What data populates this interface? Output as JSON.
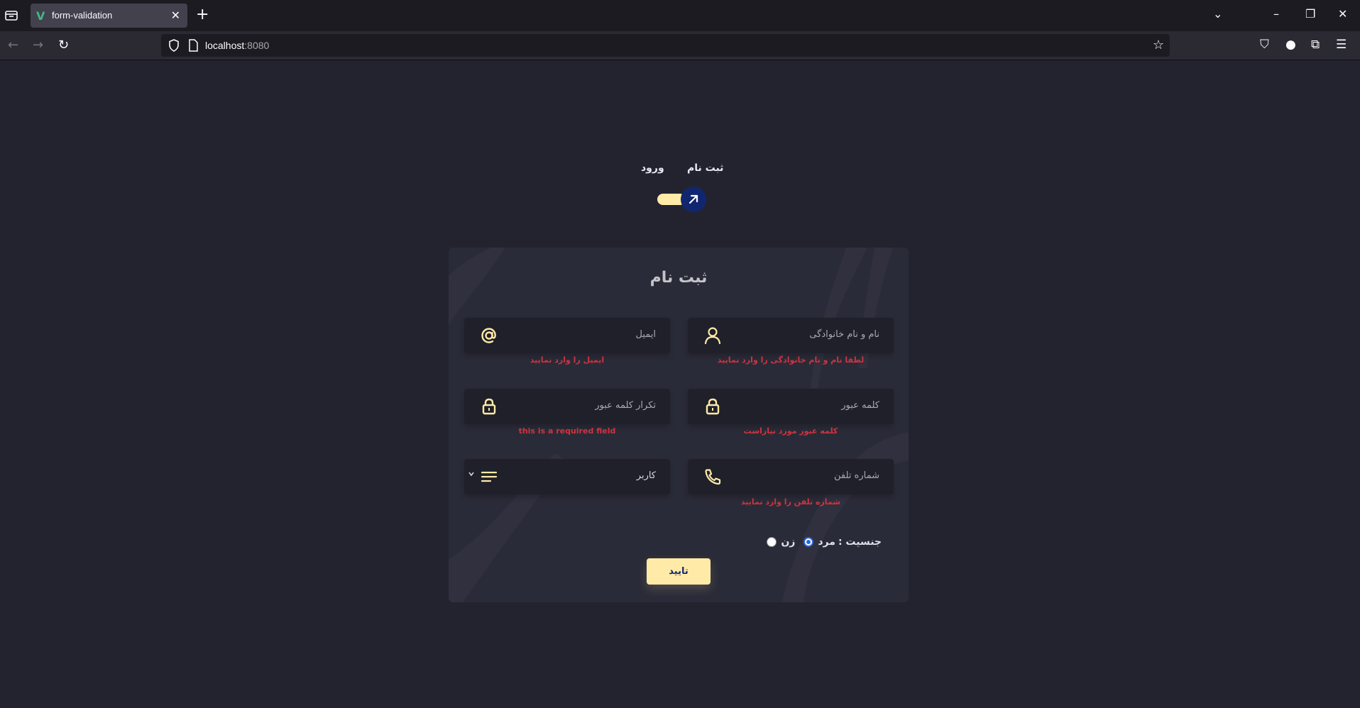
{
  "browser": {
    "tab_title": "form-validation",
    "tab_favicon": "V",
    "url_host": "localhost",
    "url_port": ":8080"
  },
  "toggle": {
    "signup_label": "ثبت نام",
    "login_label": "ورود"
  },
  "form": {
    "title": "ثبت نام",
    "fullname_placeholder": "نام و نام خانوادگی",
    "fullname_error": "لطفا نام و نام خانوادگی را وارد نمایید",
    "email_placeholder": "ایمیل",
    "email_error": "ایمیل را وارد نمایید",
    "password_placeholder": "کلمه عبور",
    "password_error": "کلمه عبور مورد نیازاست",
    "confirm_placeholder": "تکرار کلمه عبور",
    "confirm_error": "this is a required field",
    "phone_placeholder": "شماره تلفن",
    "phone_error": "شماره تلفن را وارد نمایید",
    "role_value": "کاربر",
    "gender_label": "جنسیت :",
    "gender_male": "مرد",
    "gender_female": "زن",
    "gender_selected": "male",
    "submit_label": "تایید"
  },
  "colors": {
    "accent": "#ffeba7",
    "knob": "#102770",
    "error": "#d1333f",
    "card": "#2a2b38",
    "field": "#1f2029"
  }
}
